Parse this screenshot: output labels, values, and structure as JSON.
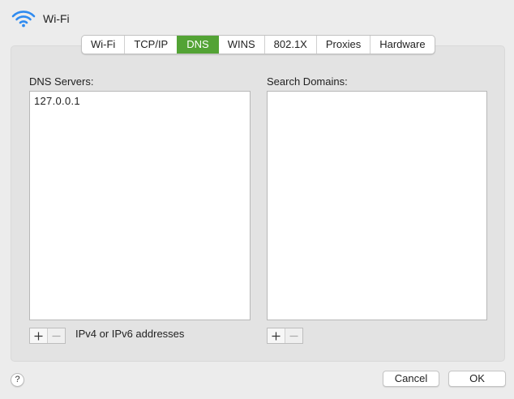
{
  "header": {
    "title": "Wi-Fi",
    "icon": "wifi-icon"
  },
  "tabs": [
    {
      "label": "Wi-Fi"
    },
    {
      "label": "TCP/IP"
    },
    {
      "label": "DNS",
      "active": true
    },
    {
      "label": "WINS"
    },
    {
      "label": "802.1X"
    },
    {
      "label": "Proxies"
    },
    {
      "label": "Hardware"
    }
  ],
  "dns": {
    "label": "DNS Servers:",
    "servers": [
      "127.0.0.1"
    ],
    "hint": "IPv4 or IPv6 addresses"
  },
  "search": {
    "label": "Search Domains:",
    "domains": []
  },
  "footer": {
    "help": "?",
    "cancel": "Cancel",
    "ok": "OK"
  },
  "colors": {
    "accent": "#53a335",
    "wifi": "#2f8bf0"
  }
}
